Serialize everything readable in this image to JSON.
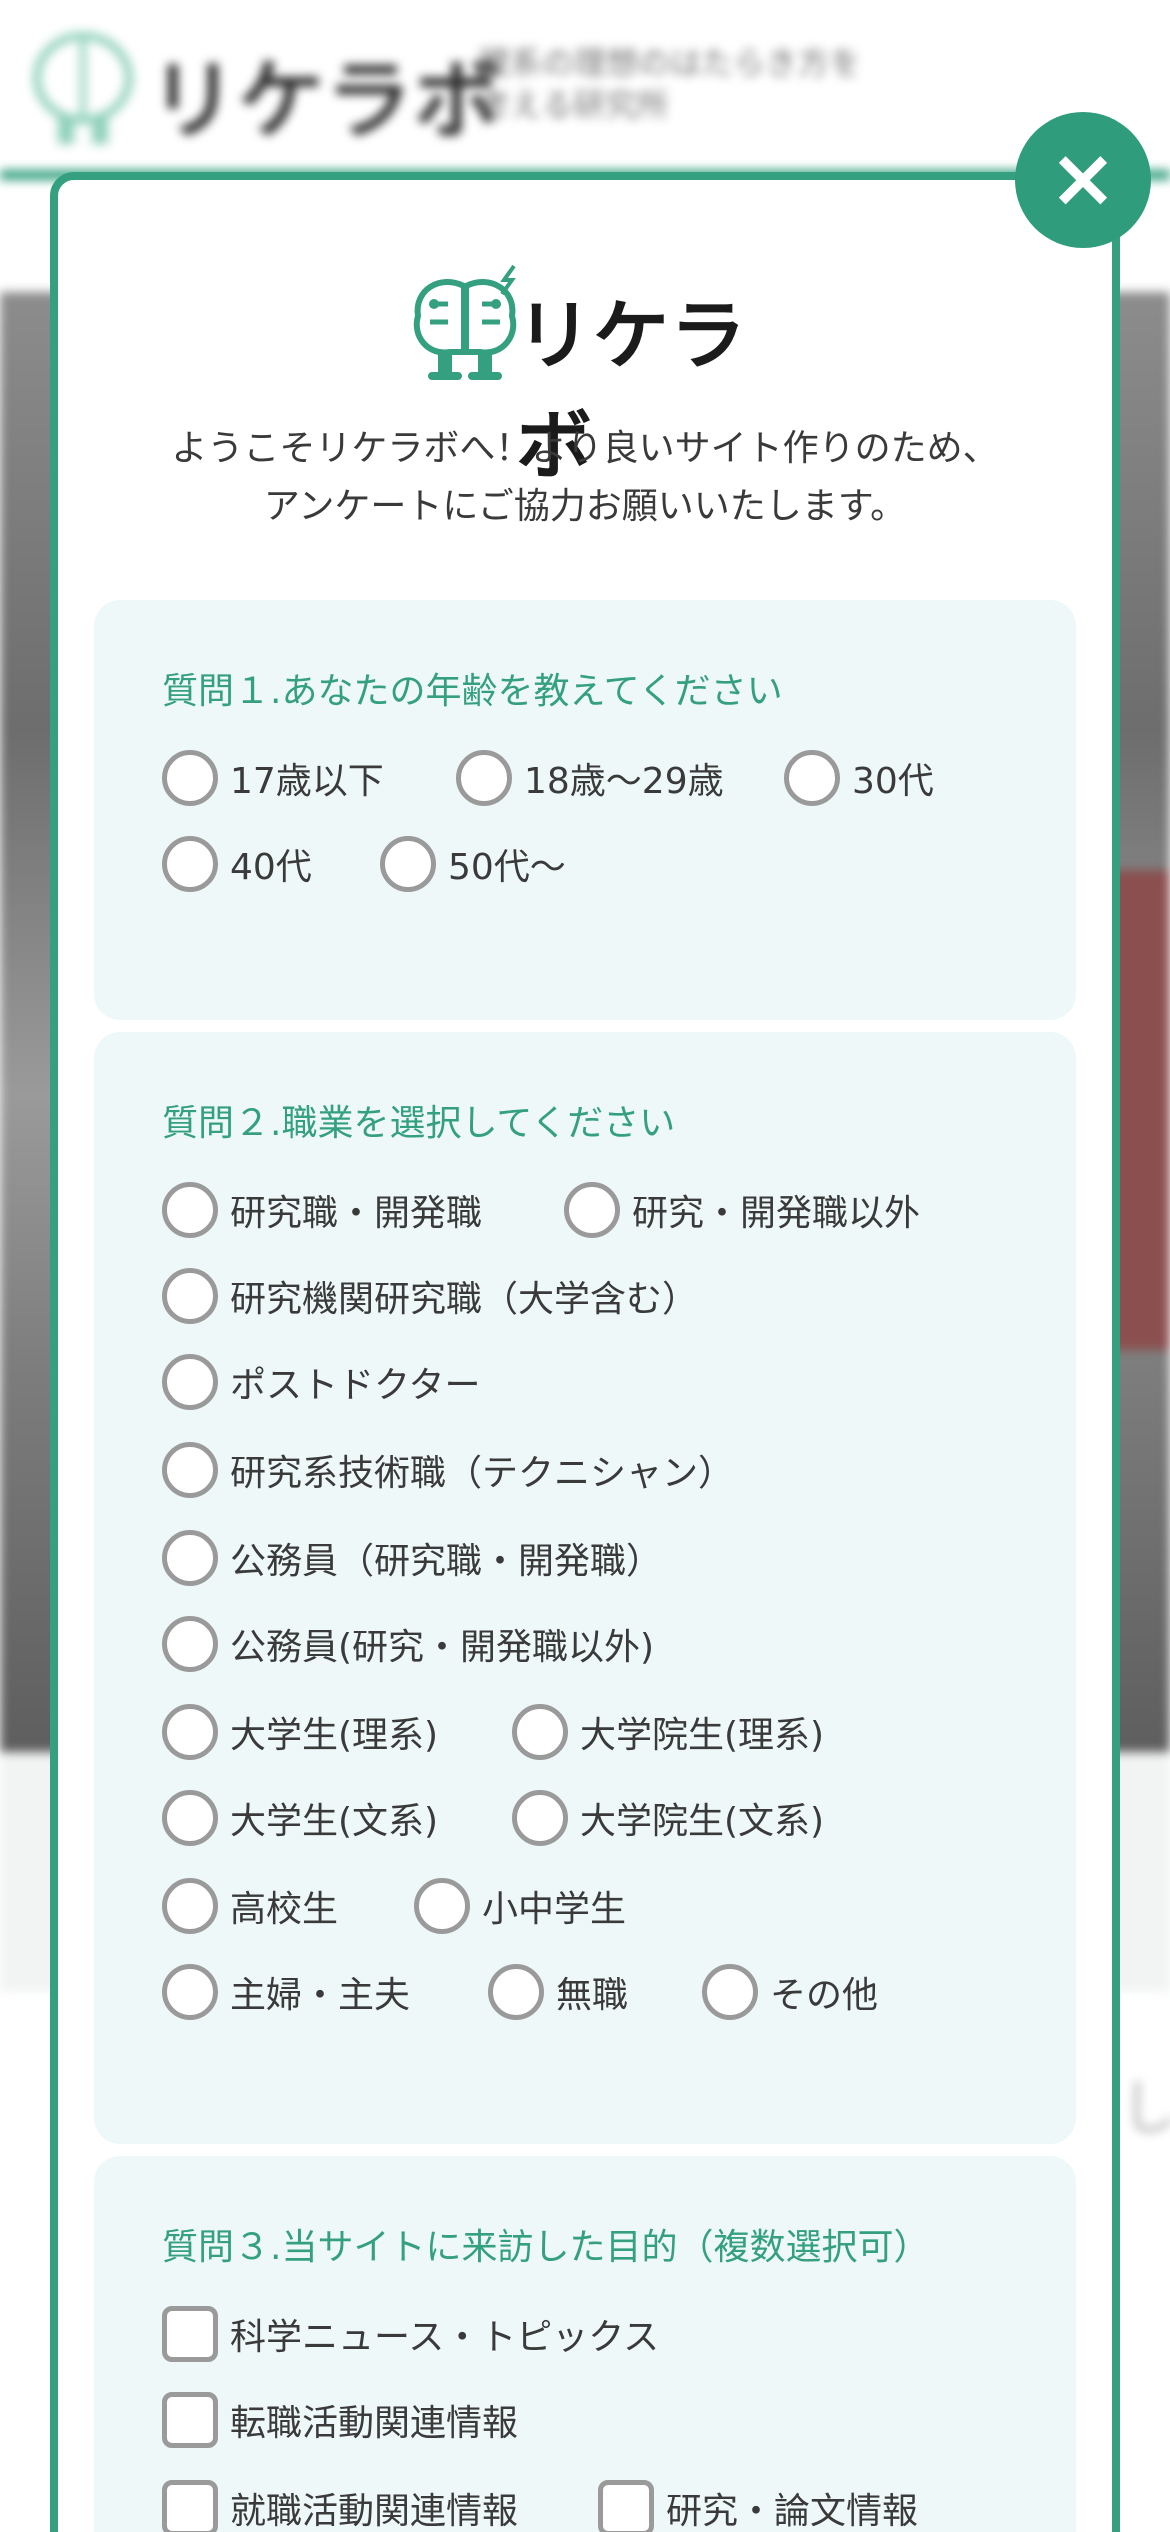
{
  "background": {
    "logo_text": "リケラボ",
    "tagline_line1": "理系の理想のはたらき方を",
    "tagline_line2": "考える研究所",
    "right_edge_text": "し"
  },
  "modal": {
    "logo_text": "リケラボ",
    "intro_line1": "ようこそリケラボへ！より良いサイト作りのため、",
    "intro_line2": "アンケートにご協力お願いいたします。",
    "close_glyph": "×"
  },
  "q1": {
    "title": "質問１.あなたの年齢を教えてください",
    "options": [
      "17歳以下",
      "18歳〜29歳",
      "30代",
      "40代",
      "50代〜"
    ]
  },
  "q2": {
    "title": "質問２.職業を選択してください",
    "options": [
      "研究職・開発職",
      "研究・開発職以外",
      "研究機関研究職（大学含む）",
      "ポストドクター",
      "研究系技術職（テクニシャン）",
      "公務員（研究職・開発職）",
      "公務員(研究・開発職以外)",
      "大学生(理系)",
      "大学院生(理系)",
      "大学生(文系)",
      "大学院生(文系)",
      "高校生",
      "小中学生",
      "主婦・主夫",
      "無職",
      "その他"
    ]
  },
  "q3": {
    "title": "質問３.当サイトに来訪した目的（複数選択可）",
    "options": [
      "科学ニュース・トピックス",
      "転職活動関連情報",
      "就職活動関連情報",
      "研究・論文情報"
    ]
  },
  "colors": {
    "brand_green": "#34a07f",
    "question_bg": "#eef8f8",
    "control_border": "#9a9a9a"
  }
}
